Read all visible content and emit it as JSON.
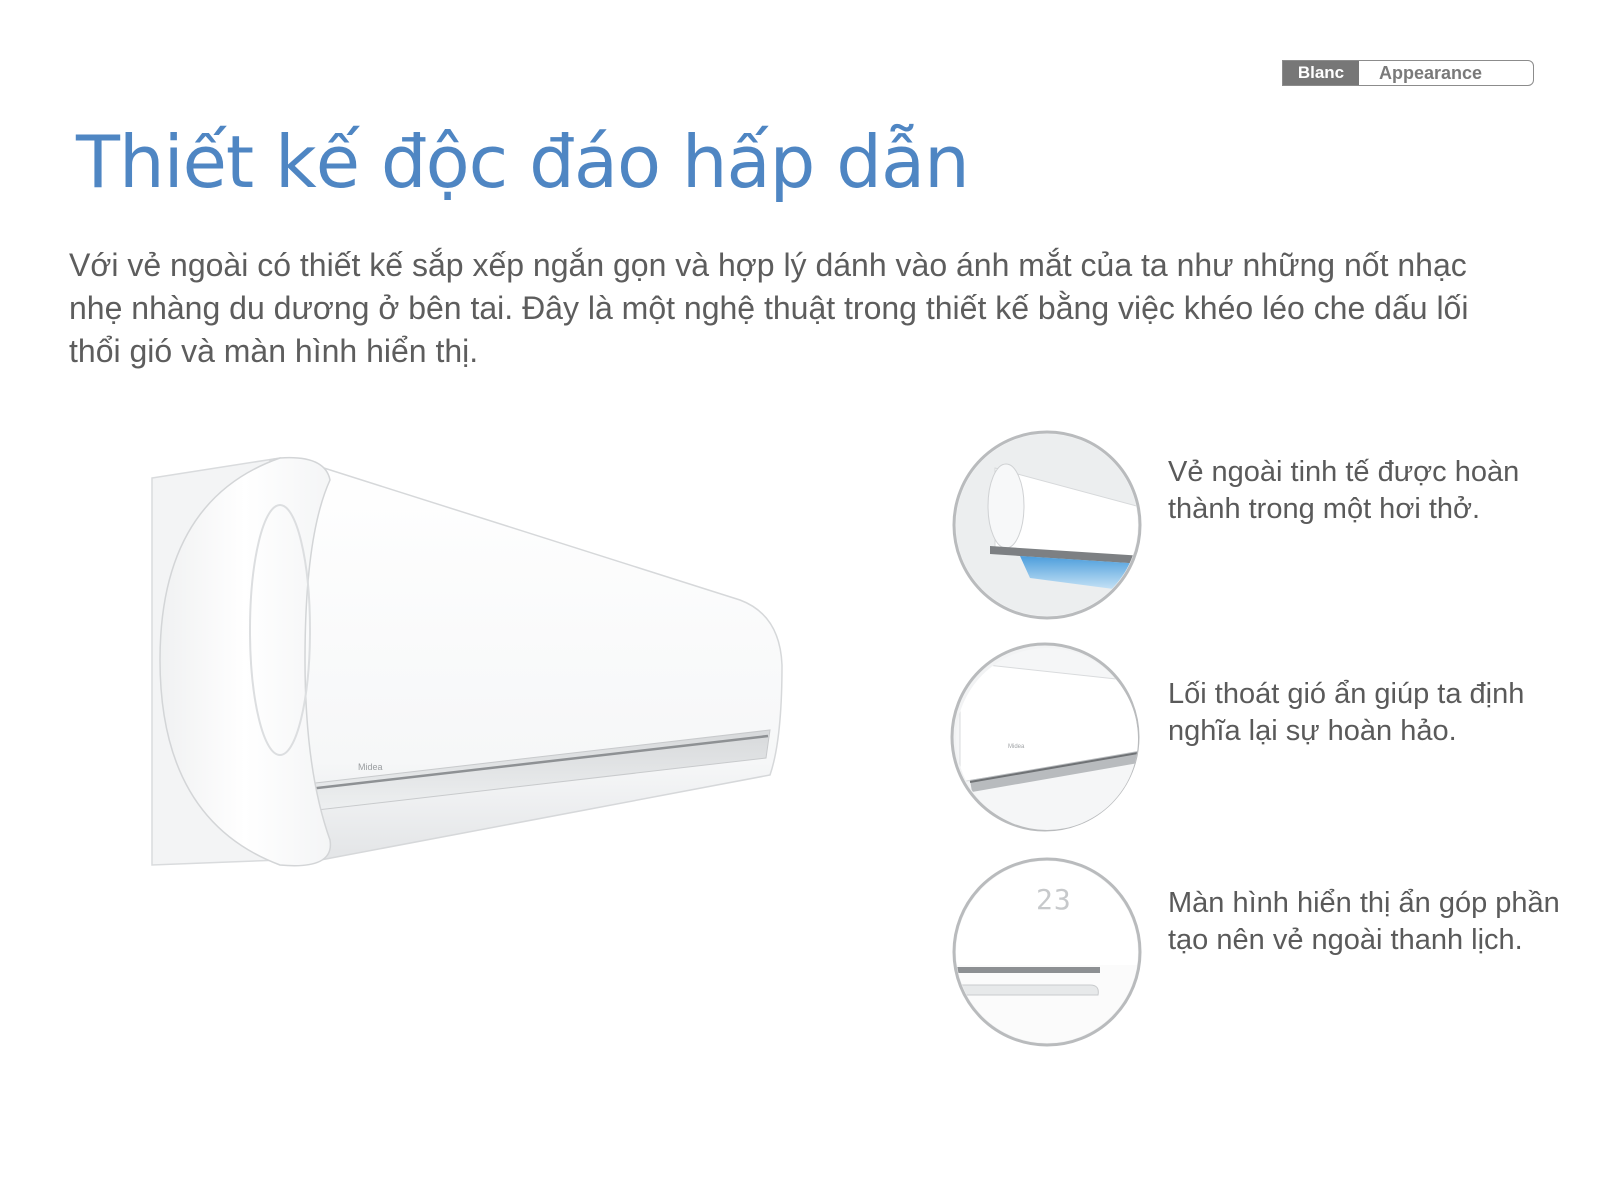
{
  "tag": {
    "dark_label": "Blanc",
    "light_label": "Appearance"
  },
  "title": "Thiết kế độc đáo hấp dẫn",
  "intro": "Với vẻ ngoài có thiết kế sắp xếp ngắn gọn và hợp lý dánh vào ánh mắt của ta như những nốt nhạc nhẹ nhàng du dương ở bên tai. Đây là một nghệ thuật trong thiết kế bằng việc khéo léo che dấu lối thổi gió và màn hình hiển thị.",
  "features": [
    {
      "caption": "Vẻ ngoài tinh tế được hoàn thành trong một hơi thở."
    },
    {
      "caption": "Lối thoát gió ẩn giúp ta định nghĩa lại sự hoàn hảo."
    },
    {
      "caption": "Màn hình hiển thị ẩn góp phần tạo nên vẻ ngoài thanh lịch.",
      "display_readout": "23"
    }
  ],
  "colors": {
    "title_blue": "#4f86c3",
    "body_text": "#5d5d5d",
    "tag_dark": "#777777",
    "airflow_blue": "#49a8e6"
  }
}
